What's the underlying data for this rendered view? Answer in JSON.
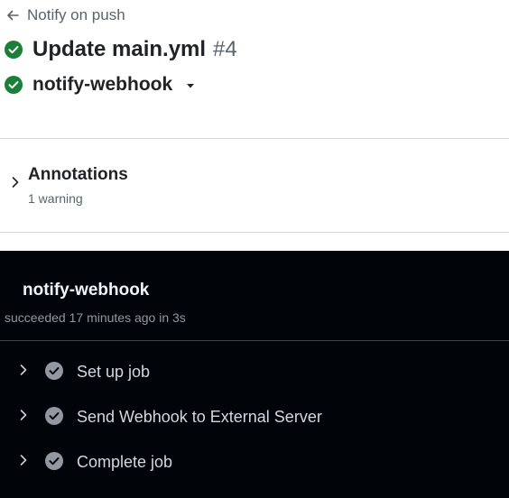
{
  "header": {
    "back_label": "Notify on push",
    "run_title": "Update main.yml",
    "run_number": "#4",
    "job_selector": "notify-webhook"
  },
  "annotations": {
    "title": "Annotations",
    "subtitle": "1 warning"
  },
  "job": {
    "name": "notify-webhook",
    "status": "succeeded 17 minutes ago in 3s",
    "steps": [
      {
        "label": "Set up job"
      },
      {
        "label": "Send Webhook to External Server"
      },
      {
        "label": "Complete job"
      }
    ]
  },
  "colors": {
    "success": "#1a7f37",
    "dark_bg": "#010409",
    "step_check": "#9198a1"
  }
}
